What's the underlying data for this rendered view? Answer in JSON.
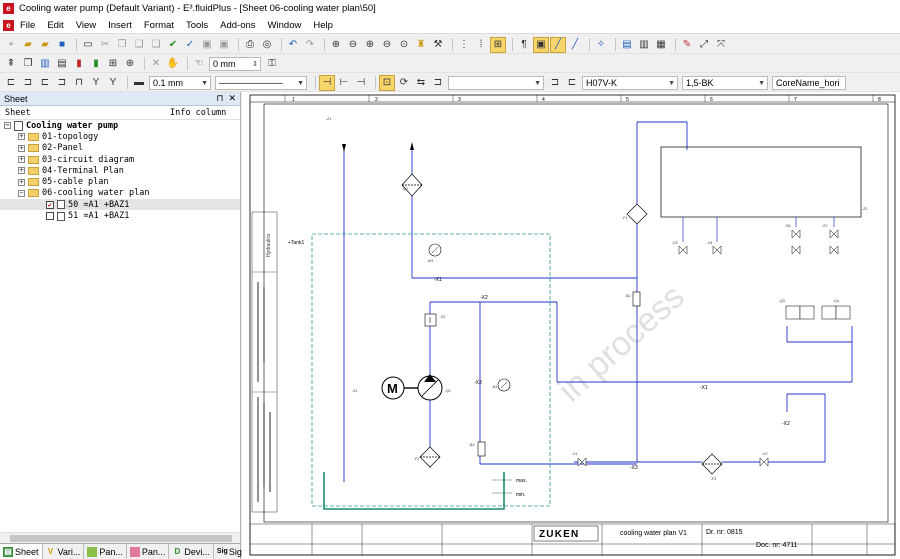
{
  "window": {
    "title": "Cooling water pump (Default Variant) - E³.fluidPlus - [Sheet 06-cooling water plan\\50]"
  },
  "menu": [
    "File",
    "Edit",
    "View",
    "Insert",
    "Format",
    "Tools",
    "Add-ons",
    "Window",
    "Help"
  ],
  "toolbar3": {
    "line_width": "0.1 mm"
  },
  "toolbar2": {
    "offset": "0 mm"
  },
  "toolbar3_right": {
    "cable_type": "H07V-K",
    "core": "1,5-BK",
    "text_type": "CoreName_hori"
  },
  "panel": {
    "title": "Sheet",
    "pin": "⊓",
    "close": "✕",
    "columns": [
      "Sheet",
      "Info column"
    ],
    "root": "Cooling water pump",
    "items": [
      "01-topology",
      "02-Panel",
      "03-circuit diagram",
      "04-Terminal Plan",
      "05-cable plan",
      "06-cooling water plan"
    ],
    "sheets": [
      "50 =A1 +BAZ1",
      "51 =A1 +BAZ1"
    ]
  },
  "tabs": [
    "Sheet",
    "Vari...",
    "Pan...",
    "Pan...",
    "Devi...",
    "Sign..."
  ],
  "drawing": {
    "columns": [
      "1",
      "2",
      "3",
      "4",
      "5",
      "6",
      "7",
      "8"
    ],
    "tank_label": "+Tank1",
    "max": "max.",
    "min": "min.",
    "hydraulics": "Hydraulics",
    "watermark": "in process",
    "motor": "M",
    "wires": [
      "-X1",
      "-X2",
      "-X3",
      "-X1",
      "-X2",
      "-X3"
    ],
    "company": "ZUKEN",
    "sheet_title": "cooling water plan V1",
    "drawing_no": "Dr. nr: 0815",
    "doc_no": "Doc. nr: 4711",
    "small_labels": [
      "-S1",
      "-Q1",
      "-S2",
      "-Q2",
      "-Q3",
      "-Q4",
      "-W1",
      "-B1",
      "-B2",
      "-B3",
      "-F1",
      "-F2",
      "-F3",
      "-V1",
      "-V2",
      "-V3",
      "-V4",
      "-S6",
      "-S7",
      "-Z1",
      "-Z2"
    ]
  }
}
